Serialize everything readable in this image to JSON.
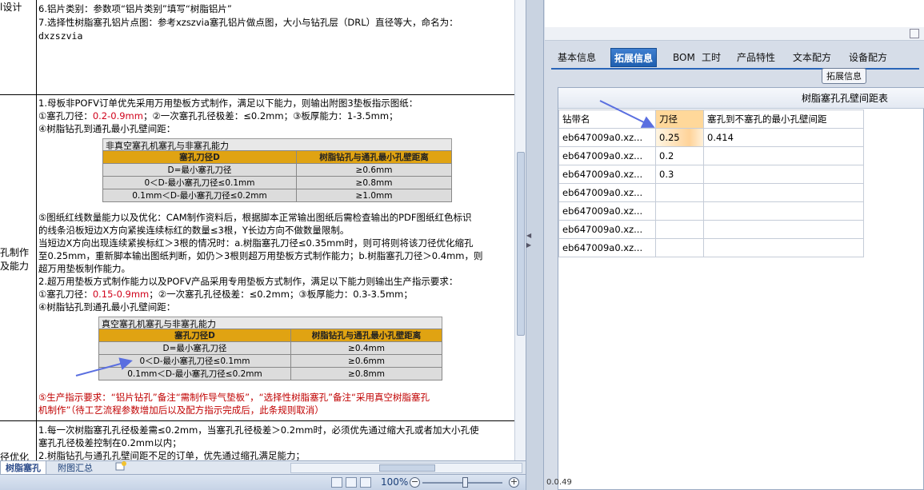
{
  "left_col": {
    "row1": "l设计",
    "row2_line1": "孔制作",
    "row2_line2": "及能力",
    "row3": "径优化"
  },
  "section1": {
    "line1": "6.铝片类别：参数项“铝片类别”填写“树脂铝片”",
    "line2": "7.选择性树脂塞孔铝片点图：参考xzszvia塞孔铝片做点图，大小与钻孔层（DRL）直径等大，命名为：",
    "line3": "dxzszvia"
  },
  "section2": {
    "l1": "1.母板非POFV订单优先采用万用垫板方式制作，满足以下能力，则输出附图3垫板指示图纸：",
    "l2_a": "①塞孔刀径：",
    "l2_red": "0.2-0.9mm",
    "l2_b": "；②一次塞孔孔径极差：≤0.2mm；③板厚能力：1-3.5mm；",
    "l3": "④树脂钻孔到通孔最小孔壁间距：",
    "table1": {
      "title": "非真空塞孔机塞孔与非塞孔能力",
      "headers": [
        "塞孔刀径D",
        "树脂钻孔与通孔最小孔壁距离"
      ],
      "rows": [
        [
          "D=最小塞孔刀径",
          "≥0.6mm"
        ],
        [
          "0＜D-最小塞孔刀径≤0.1mm",
          "≥0.8mm"
        ],
        [
          "0.1mm＜D-最小塞孔刀径≤0.2mm",
          "≥1.0mm"
        ]
      ]
    },
    "l4": "⑤图纸红线数量能力以及优化：CAM制作资料后，根据脚本正常输出图纸后需检查输出的PDF图纸红色标识",
    "l5": "的线条沿板短边X方向紧挨连续标红的数量≤3根，Y长边方向不做数量限制。",
    "l6": "当短边X方向出现连续紧挨标红＞3根的情况时：a.树脂塞孔刀径≤0.35mm时，则可将则将该刀径优化缩孔",
    "l7": "至0.25mm，重新脚本输出图纸判断，如仍＞3根则超万用垫板方式制作能力；b.树脂塞孔刀径＞0.4mm，则",
    "l8": "超万用垫板制作能力。",
    "l9": "2.超万用垫板方式制作能力以及POFV产品采用专用垫板方式制作，满足以下能力则输出生产指示要求：",
    "l10_a": "①塞孔刀径：",
    "l10_red": "0.15-0.9mm",
    "l10_b": "；②一次塞孔孔径极差：≤0.2mm；③板厚能力：0.3-3.5mm；",
    "l11": "④树脂钻孔到通孔最小孔壁间距：",
    "table2": {
      "title": "真空塞孔机塞孔与非塞孔能力",
      "headers": [
        "塞孔刀径D",
        "树脂钻孔与通孔最小孔壁距离"
      ],
      "rows": [
        [
          "D=最小塞孔刀径",
          "≥0.4mm"
        ],
        [
          "0＜D-最小塞孔刀径≤0.1mm",
          "≥0.6mm"
        ],
        [
          "0.1mm＜D-最小塞孔刀径≤0.2mm",
          "≥0.8mm"
        ]
      ]
    },
    "l12": "⑤生产指示要求：“铝片钻孔”备注“需制作导气垫板”，“选择性树脂塞孔”备注“采用真空树脂塞孔",
    "l13": "机制作”（待工艺流程参数增加后以及配方指示完成后，此条规则取消）"
  },
  "section3": {
    "l1": "1.每一次树脂塞孔孔径极差需≤0.2mm，当塞孔孔径极差＞0.2mm时，必须优先通过缩大孔或者加大小孔使",
    "l2": "塞孔孔径极差控制在0.2mm以内；",
    "l3": "2.树脂钻孔与通孔孔壁间距不足的订单，优先通过缩孔满足能力；"
  },
  "sheet_tabs": [
    "树脂塞孔",
    "附图汇总"
  ],
  "zoom": "100%",
  "right": {
    "tabs": [
      "基本信息",
      "拓展信息",
      "BOM",
      "工时",
      "产品特性",
      "文本配方",
      "设备配方"
    ],
    "active_tab": "拓展信息",
    "tooltip": "拓展信息",
    "grid_caption": "树脂塞孔孔壁间距表",
    "grid_headers": [
      "钻带名",
      "刀径",
      "塞孔到不塞孔的最小孔壁间距"
    ],
    "grid_rows": [
      [
        "eb647009a0.xz...",
        "0.25",
        "0.414"
      ],
      [
        "eb647009a0.xz...",
        "0.2",
        ""
      ],
      [
        "eb647009a0.xz...",
        "0.3",
        ""
      ],
      [
        "eb647009a0.xz...",
        "",
        ""
      ],
      [
        "eb647009a0.xz...",
        "",
        ""
      ],
      [
        "eb647009a0.xz...",
        "",
        ""
      ],
      [
        "eb647009a0.xz...",
        "",
        ""
      ]
    ],
    "status": "0.0.49"
  },
  "colors": {
    "accent_tab": "#2a65b8",
    "table_header": "#e0a312",
    "red_text": "#d0021b",
    "arrow": "#5a6fe0"
  }
}
